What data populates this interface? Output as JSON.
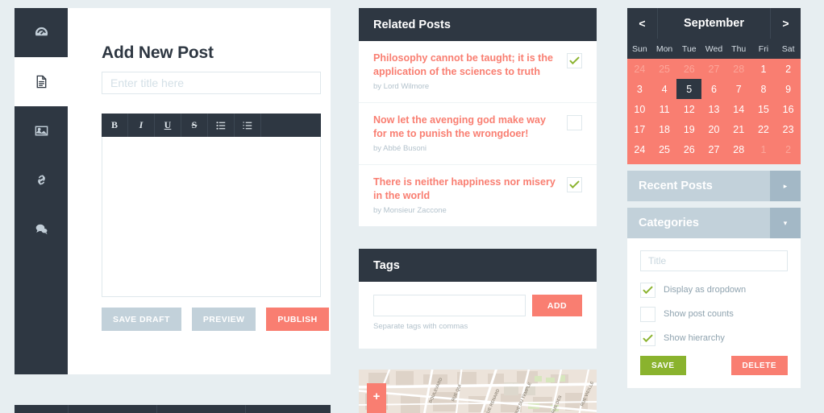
{
  "sidebar": {
    "items": [
      {
        "name": "dashboard",
        "icon": "gauge-icon",
        "active": false
      },
      {
        "name": "posts",
        "icon": "document-icon",
        "active": true
      },
      {
        "name": "media",
        "icon": "image-icon",
        "active": false
      },
      {
        "name": "links",
        "icon": "link-icon",
        "active": false
      },
      {
        "name": "comments",
        "icon": "comment-icon",
        "active": false
      }
    ]
  },
  "editor": {
    "page_title": "Add New Post",
    "title_placeholder": "Enter title here",
    "title_value": "",
    "toolbar": [
      {
        "label": "B",
        "name": "bold-icon"
      },
      {
        "label": "I",
        "name": "italic-icon"
      },
      {
        "label": "U",
        "name": "underline-icon"
      },
      {
        "label": "S",
        "name": "strikethrough-icon"
      },
      {
        "label": "",
        "name": "unordered-list-icon"
      },
      {
        "label": "",
        "name": "ordered-list-icon"
      }
    ],
    "body_value": "",
    "buttons": {
      "save_draft": "SAVE DRAFT",
      "preview": "PREVIEW",
      "publish": "PUBLISH"
    }
  },
  "related_posts": {
    "title": "Related Posts",
    "items": [
      {
        "title": "Philosophy cannot be taught; it is the application of the sciences to truth",
        "author": "by Lord Wilmore",
        "checked": true
      },
      {
        "title": "Now let the avenging god make way for me to punish the wrongdoer!",
        "author": "by Abbé Busoni",
        "checked": false
      },
      {
        "title": "There is neither happiness nor misery in the world",
        "author": "by Monsieur Zaccone",
        "checked": true
      }
    ]
  },
  "tags": {
    "title": "Tags",
    "input_value": "",
    "input_placeholder": "",
    "add_label": "ADD",
    "hint": "Separate tags with commas"
  },
  "map": {
    "zoom_in_label": "+",
    "street_labels": [
      "BOULEVARD",
      "RUE QUI",
      "RUE RENARD",
      "RUE DU TEMPLE",
      "RUE DES",
      "RUE VIEILLE"
    ]
  },
  "calendar": {
    "month": "September",
    "prev_label": "<",
    "next_label": ">",
    "dow": [
      "Sun",
      "Mon",
      "Tue",
      "Wed",
      "Thu",
      "Fri",
      "Sat"
    ],
    "days": [
      {
        "d": "24",
        "muted": true
      },
      {
        "d": "25",
        "muted": true
      },
      {
        "d": "26",
        "muted": true
      },
      {
        "d": "27",
        "muted": true
      },
      {
        "d": "28",
        "muted": true
      },
      {
        "d": "1",
        "muted": false
      },
      {
        "d": "2",
        "muted": false
      },
      {
        "d": "3",
        "muted": false
      },
      {
        "d": "4",
        "muted": false
      },
      {
        "d": "5",
        "muted": false,
        "selected": true
      },
      {
        "d": "6",
        "muted": false
      },
      {
        "d": "7",
        "muted": false
      },
      {
        "d": "8",
        "muted": false
      },
      {
        "d": "9",
        "muted": false
      },
      {
        "d": "10",
        "muted": false
      },
      {
        "d": "11",
        "muted": false
      },
      {
        "d": "12",
        "muted": false
      },
      {
        "d": "13",
        "muted": false
      },
      {
        "d": "14",
        "muted": false
      },
      {
        "d": "15",
        "muted": false
      },
      {
        "d": "16",
        "muted": false
      },
      {
        "d": "17",
        "muted": false
      },
      {
        "d": "18",
        "muted": false
      },
      {
        "d": "19",
        "muted": false
      },
      {
        "d": "20",
        "muted": false
      },
      {
        "d": "21",
        "muted": false
      },
      {
        "d": "22",
        "muted": false
      },
      {
        "d": "23",
        "muted": false
      },
      {
        "d": "24",
        "muted": false
      },
      {
        "d": "25",
        "muted": false
      },
      {
        "d": "26",
        "muted": false
      },
      {
        "d": "27",
        "muted": false
      },
      {
        "d": "28",
        "muted": false
      },
      {
        "d": "1",
        "muted": true
      },
      {
        "d": "2",
        "muted": true
      }
    ],
    "selected_day": "5"
  },
  "recent_posts": {
    "title": "Recent Posts",
    "toggle_label": "▸",
    "collapsed": true
  },
  "categories": {
    "title": "Categories",
    "toggle_label": "▾",
    "collapsed": false,
    "title_placeholder": "Title",
    "title_value": "",
    "options": [
      {
        "label": "Display as dropdown",
        "checked": true
      },
      {
        "label": "Show post counts",
        "checked": false
      },
      {
        "label": "Show hierarchy",
        "checked": true
      }
    ],
    "save_label": "SAVE",
    "delete_label": "DELETE"
  },
  "colors": {
    "background": "#e7eef1",
    "dark": "#2e3742",
    "coral": "#f97e71",
    "green": "#8ab32e",
    "muted_blue": "#c2d1da",
    "toggle_blue": "#a3b8c6"
  }
}
